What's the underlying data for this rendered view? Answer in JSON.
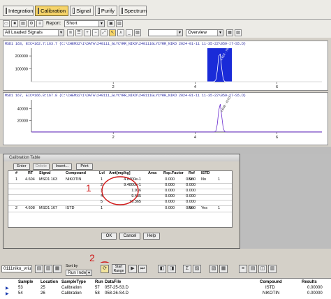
{
  "tabs": [
    {
      "label": "Integration",
      "active": false
    },
    {
      "label": "Calibration",
      "active": true
    },
    {
      "label": "Signal",
      "active": false
    },
    {
      "label": "Purify",
      "active": false
    },
    {
      "label": "Spectrum",
      "active": false
    }
  ],
  "toolbar": {
    "report_label": "Report:",
    "report_value": "Short",
    "signals_value": "All Loaded Signals",
    "view_value": "Overview"
  },
  "chart_data": [
    {
      "type": "line",
      "title": "MSD1 163, EIC=162.7:163.7 (C:\\CHEM32\\1\\DATA\\240111_GLYCYRR_NIKO\\240111GLYCYRR_NIKO 2024-01-11 11-35-22\\059-27-S5.D)",
      "yticks": [
        "200000",
        "100000"
      ],
      "xticks": [
        "2",
        "4",
        "6"
      ],
      "xlim": [
        0,
        7.1
      ],
      "ylim": [
        0,
        260000
      ],
      "peak_x": 4.6,
      "highlighted_range": [
        4.3,
        4.9
      ],
      "peak_label": "4.604 - NIKOTIN"
    },
    {
      "type": "line",
      "title": "MSD1 167, EIC=166.8:167.8 (C:\\CHEM32\\1\\DATA\\240111_GLYCYRR_NIKO\\240111GLYCYRR_NIKO 2024-01-11 11-35-22\\059-27-S5.D)",
      "yticks": [
        "40000",
        "20000"
      ],
      "xticks": [
        "2",
        "4",
        "6"
      ],
      "xlim": [
        0,
        7.1
      ],
      "ylim": [
        0,
        55000
      ],
      "peak_x": 4.608,
      "peak_label": "4.608 - ISTD"
    }
  ],
  "calibration": {
    "title": "Calibration Table",
    "buttons": [
      "Enter",
      "Delete",
      "Insert...",
      "Print"
    ],
    "headers": [
      "#",
      "RT",
      "Signal",
      "Compound",
      "Lvl",
      "Amt[mg/kg]",
      "Area",
      "Rsp.Factor",
      "Ref",
      "ISTD"
    ],
    "rows": [
      {
        "num": "1",
        "rt": "4.604",
        "signal": "MSD1 163",
        "compound": "NIKOTIN",
        "lvl": "1",
        "amt": "4.8400e-1",
        "area": "0.000",
        "rsp": "0.000",
        "ref": "No",
        "istd": "No",
        "extra": "1"
      },
      {
        "num": "",
        "rt": "",
        "signal": "",
        "compound": "",
        "lvl": "2",
        "amt": "9.4800e-1",
        "area": "0.000",
        "rsp": "0.000",
        "ref": "",
        "istd": "",
        "extra": ""
      },
      {
        "num": "",
        "rt": "",
        "signal": "",
        "compound": "",
        "lvl": "3",
        "amt": "1.936",
        "area": "0.000",
        "rsp": "0.000",
        "ref": "",
        "istd": "",
        "extra": ""
      },
      {
        "num": "",
        "rt": "",
        "signal": "",
        "compound": "",
        "lvl": "4",
        "amt": "9.485",
        "area": "0.000",
        "rsp": "0.000",
        "ref": "",
        "istd": "",
        "extra": ""
      },
      {
        "num": "",
        "rt": "",
        "signal": "",
        "compound": "",
        "lvl": "5",
        "amt": "19.365",
        "area": "0.000",
        "rsp": "0.000",
        "ref": "",
        "istd": "",
        "extra": ""
      },
      {
        "num": "2",
        "rt": "4.608",
        "signal": "MSD1 167",
        "compound": "ISTD",
        "lvl": "1",
        "amt": "",
        "area": "0.000",
        "rsp": "0.000",
        "ref": "No",
        "istd": "Yes",
        "extra": "1"
      }
    ],
    "ok_label": "OK",
    "cancel_label": "Cancel",
    "help_label": "Help"
  },
  "annotations": {
    "one": "1",
    "two": "2"
  },
  "controls": {
    "file_value": "0111niko_vriu",
    "sort_label": "Sort by",
    "sort_value": "Run Index",
    "start_label": "Start",
    "stop_label": "Range"
  },
  "sample_table": {
    "headers": [
      "Sample",
      "Location",
      "SampleType",
      "Run",
      "DataFile"
    ],
    "rows": [
      {
        "sample": "53",
        "location": "25",
        "type": "Calibration",
        "run": "57",
        "file": "057-25-S3.D"
      },
      {
        "sample": "54",
        "location": "26",
        "type": "Calibration",
        "run": "58",
        "file": "058-26-S4.D"
      }
    ]
  },
  "compound_table": {
    "headers": [
      "Compound",
      "Results"
    ],
    "rows": [
      {
        "compound": "ISTD",
        "result": "0.00000"
      },
      {
        "compound": "NIKOTIN",
        "result": "0.00000"
      }
    ]
  },
  "colors": {
    "accent_tab": "#f6d46a",
    "peak_fill": "#1a2bd8",
    "annotation": "#d01818",
    "trace": "#6a2bd0"
  }
}
